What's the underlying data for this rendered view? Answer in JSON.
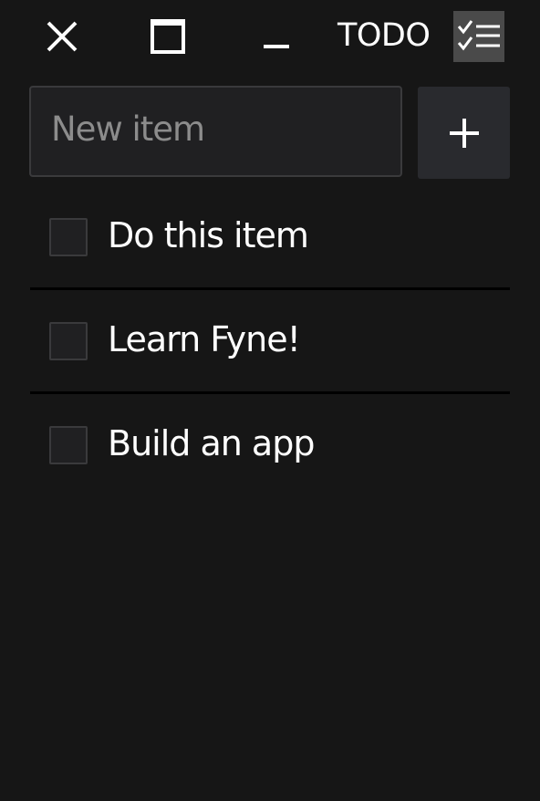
{
  "window": {
    "title": "TODO",
    "controls": {
      "close_icon": "close-icon",
      "maximize_icon": "maximize-icon",
      "minimize_icon": "minimize-icon"
    },
    "app_icon": "checklist-icon"
  },
  "new_item": {
    "value": "",
    "placeholder": "New item",
    "add_icon": "plus-icon"
  },
  "todos": [
    {
      "label": "Do this item",
      "checked": false
    },
    {
      "label": "Learn Fyne!",
      "checked": false
    },
    {
      "label": "Build an app",
      "checked": false
    }
  ],
  "colors": {
    "background": "#161616",
    "field": "#202022",
    "border": "#3a3a3c",
    "button": "#292a2e",
    "app_icon_bg": "#4a4a4a",
    "text": "#ffffff",
    "placeholder": "#8c8c8c"
  }
}
